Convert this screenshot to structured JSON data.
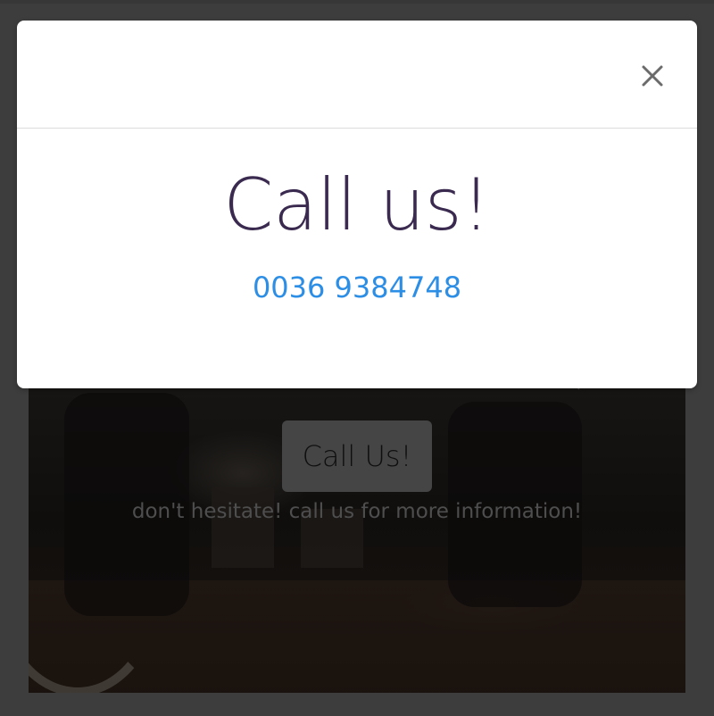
{
  "modal": {
    "title": "Call us!",
    "phone": "0036 9384748",
    "close_icon": "close-icon"
  },
  "hero": {
    "button_label": "Call Us!",
    "text": "don't hesitate! call us for more information!"
  },
  "colors": {
    "title": "#3a2a4f",
    "link": "#2d8ee6",
    "backdrop": "#7a7a7a"
  }
}
